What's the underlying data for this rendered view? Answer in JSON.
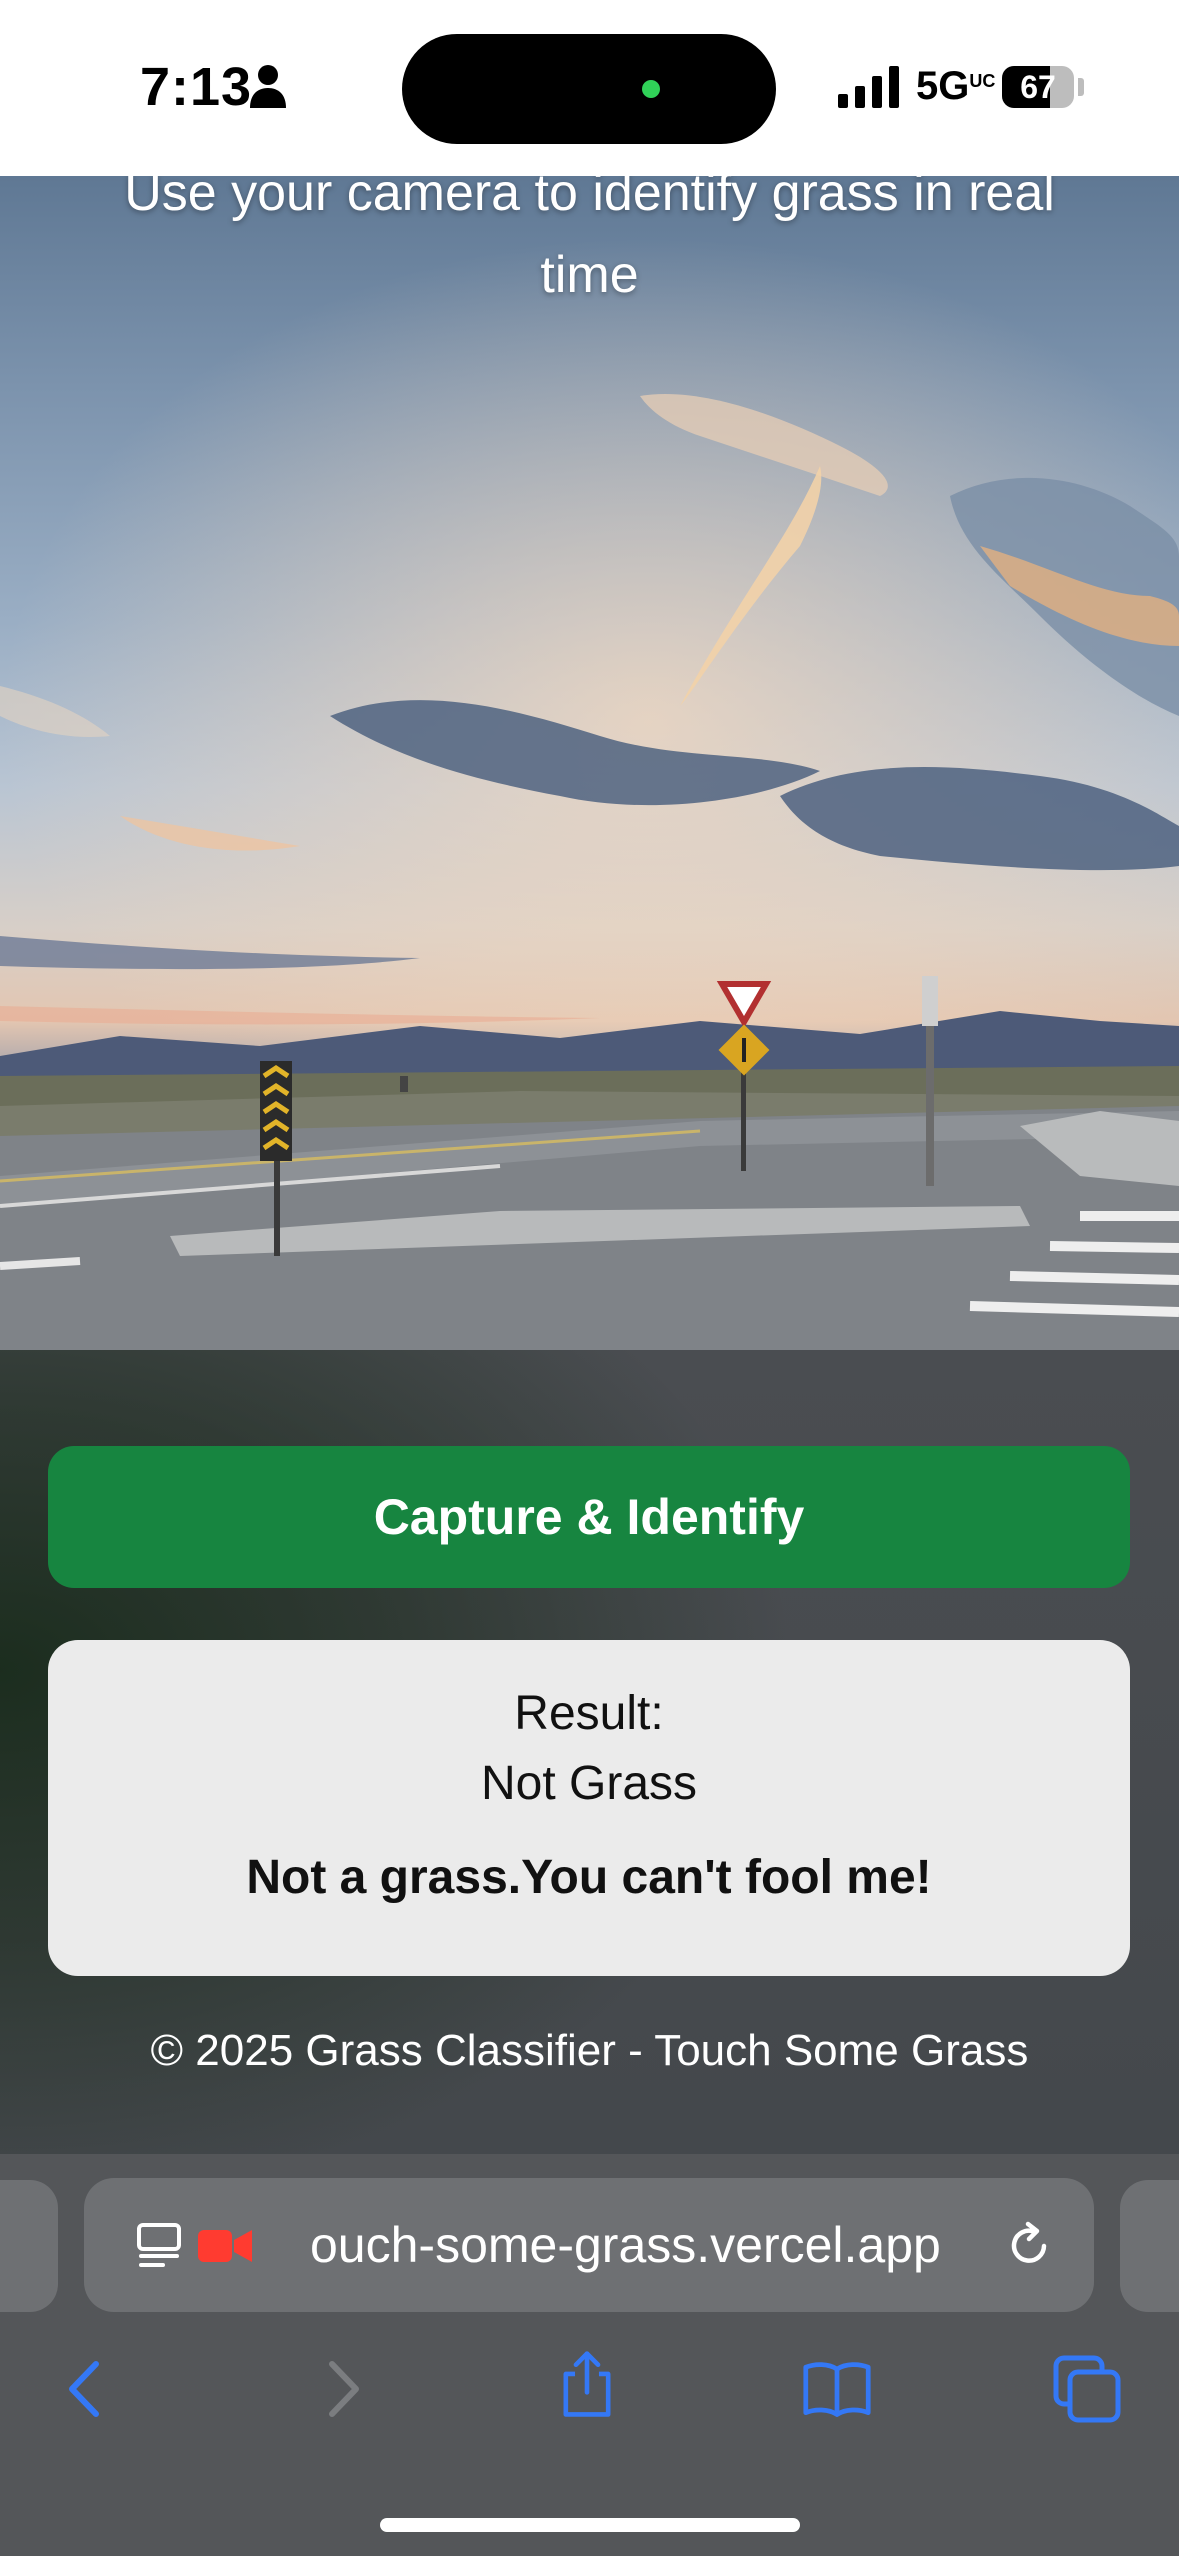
{
  "status_bar": {
    "time": "7:13",
    "network": "5G",
    "network_suffix": "UC",
    "battery": "67",
    "battery_level": 0.67
  },
  "camera": {
    "subtitle_line1": "Use your camera to identify grass in real",
    "subtitle_line2": "time"
  },
  "actions": {
    "capture_label": "Capture & Identify"
  },
  "result": {
    "label": "Result:",
    "value": "Not Grass",
    "message": "Not a grass.You can't fool me!"
  },
  "footer": {
    "text": "© 2025 Grass Classifier - Touch Some Grass"
  },
  "browser": {
    "url": "ouch-some-grass.vercel.app",
    "icons": [
      "reader-icon",
      "camera-recording-icon",
      "reload-icon",
      "back-icon",
      "forward-icon",
      "share-icon",
      "bookmarks-icon",
      "tabs-icon"
    ],
    "accent_color": "#3478f6"
  },
  "colors": {
    "capture_button": "#178540",
    "result_card": "#ebebeb",
    "recording": "#ff3b30"
  }
}
